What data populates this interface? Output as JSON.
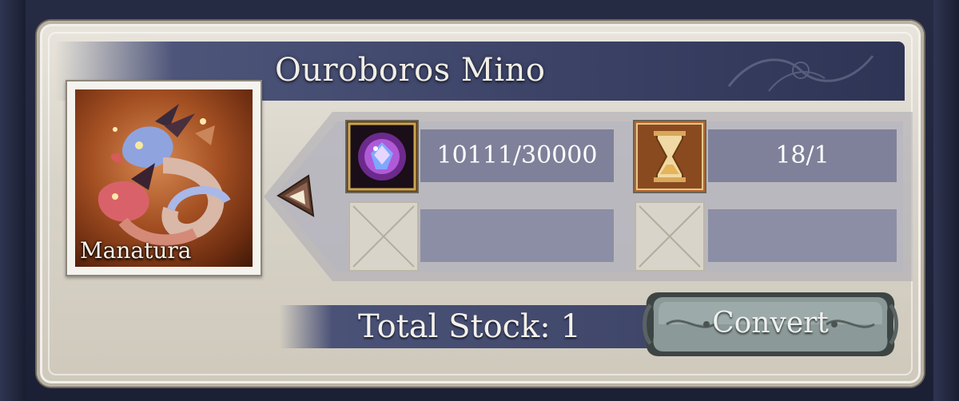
{
  "unit": {
    "name": "Ouroboros Mino",
    "portrait_label": "Manatura"
  },
  "materials": [
    {
      "icon": "arcana-crystal-icon",
      "value": "10111/30000"
    },
    {
      "icon": "hourglass-icon",
      "value": "18/1"
    },
    {
      "icon": "empty-slot-icon",
      "value": ""
    },
    {
      "icon": "empty-slot-icon",
      "value": ""
    }
  ],
  "stock": {
    "label": "Total Stock: 1"
  },
  "actions": {
    "convert_label": "Convert"
  },
  "colors": {
    "title_band": "#3b4266",
    "value_bar": "#7e8199",
    "panel": "#e0dbd1",
    "button": "#7f8d8c"
  }
}
